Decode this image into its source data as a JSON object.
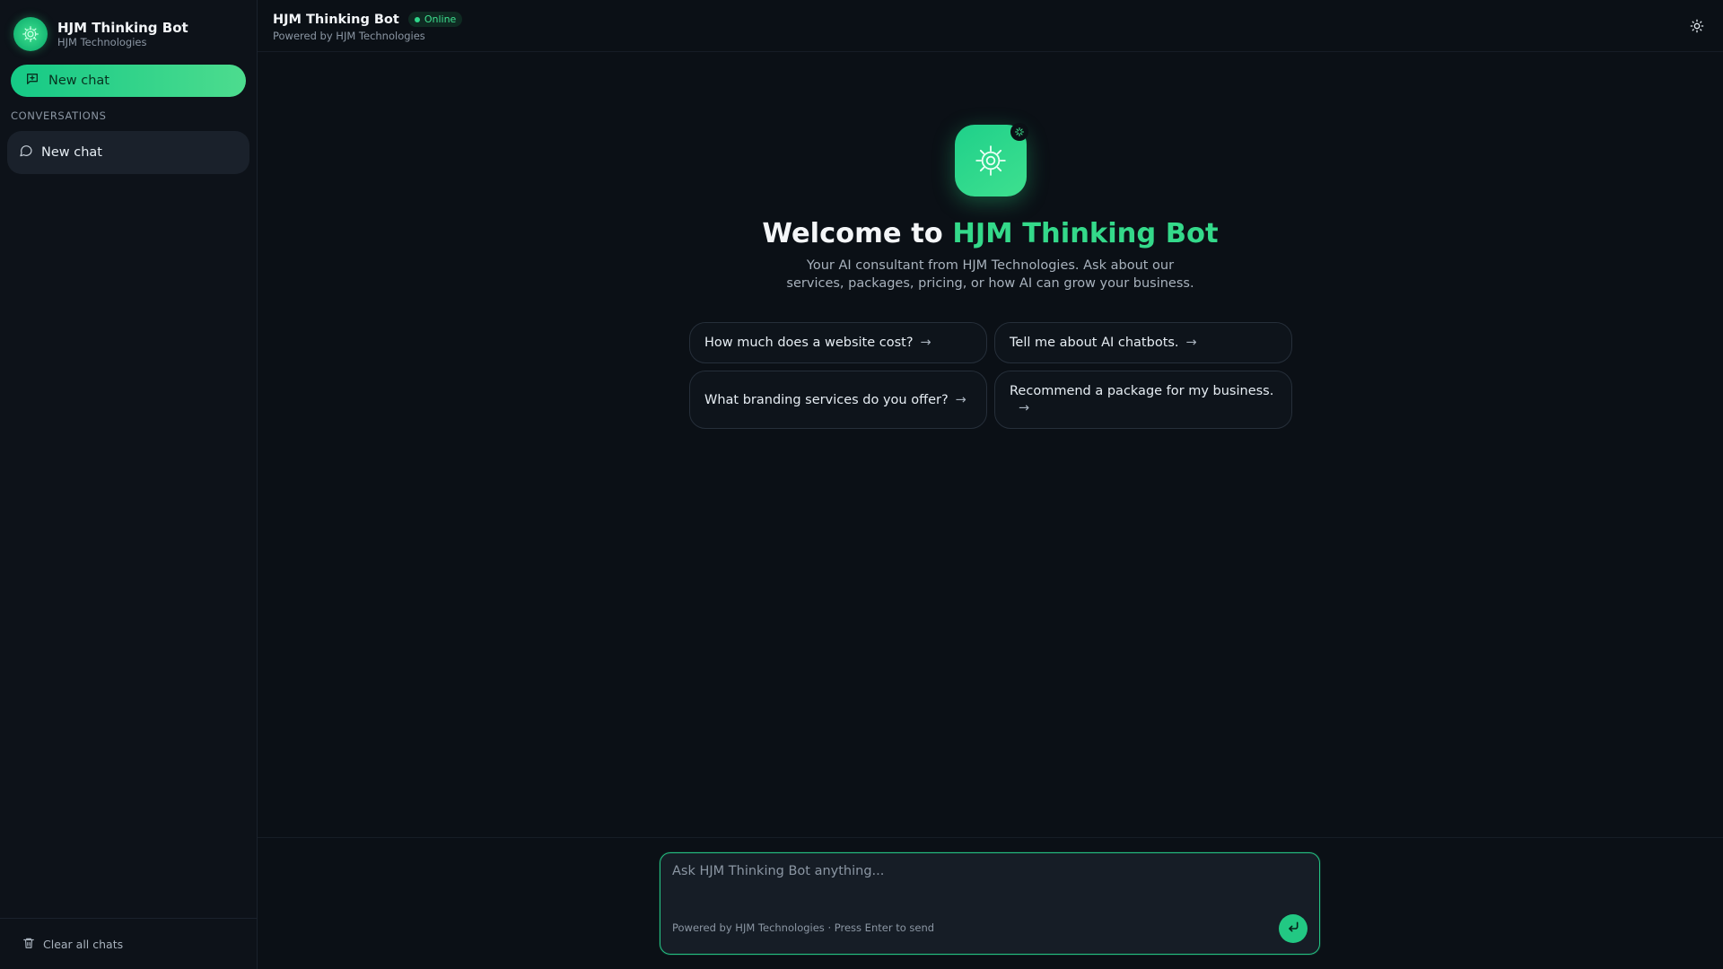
{
  "sidebar": {
    "brand_title": "HJM Thinking Bot",
    "brand_subtitle": "HJM Technologies",
    "new_chat_label": "New chat",
    "section_label": "CONVERSATIONS",
    "conversations": [
      {
        "label": "New chat"
      }
    ],
    "clear_label": "Clear all chats"
  },
  "header": {
    "title": "HJM Thinking Bot",
    "status": "Online",
    "subtitle": "Powered by HJM Technologies",
    "theme_icon": "sun-icon"
  },
  "hero": {
    "welcome_prefix": "Welcome to ",
    "welcome_accent": "HJM Thinking Bot",
    "description": "Your AI consultant from HJM Technologies. Ask about our services, packages, pricing, or how AI can grow your business."
  },
  "suggestions": [
    {
      "label": "How much does a website cost?"
    },
    {
      "label": "Tell me about AI chatbots."
    },
    {
      "label": "What branding services do you offer?"
    },
    {
      "label": "Recommend a package for my business."
    }
  ],
  "suggestion_arrow": "→",
  "composer": {
    "placeholder": "Ask HJM Thinking Bot anything...",
    "value": "",
    "hint": "Powered by HJM Technologies · Press Enter to send"
  },
  "colors": {
    "accent": "#22c883",
    "background": "#0b1016",
    "sidebar": "#0d1219"
  }
}
